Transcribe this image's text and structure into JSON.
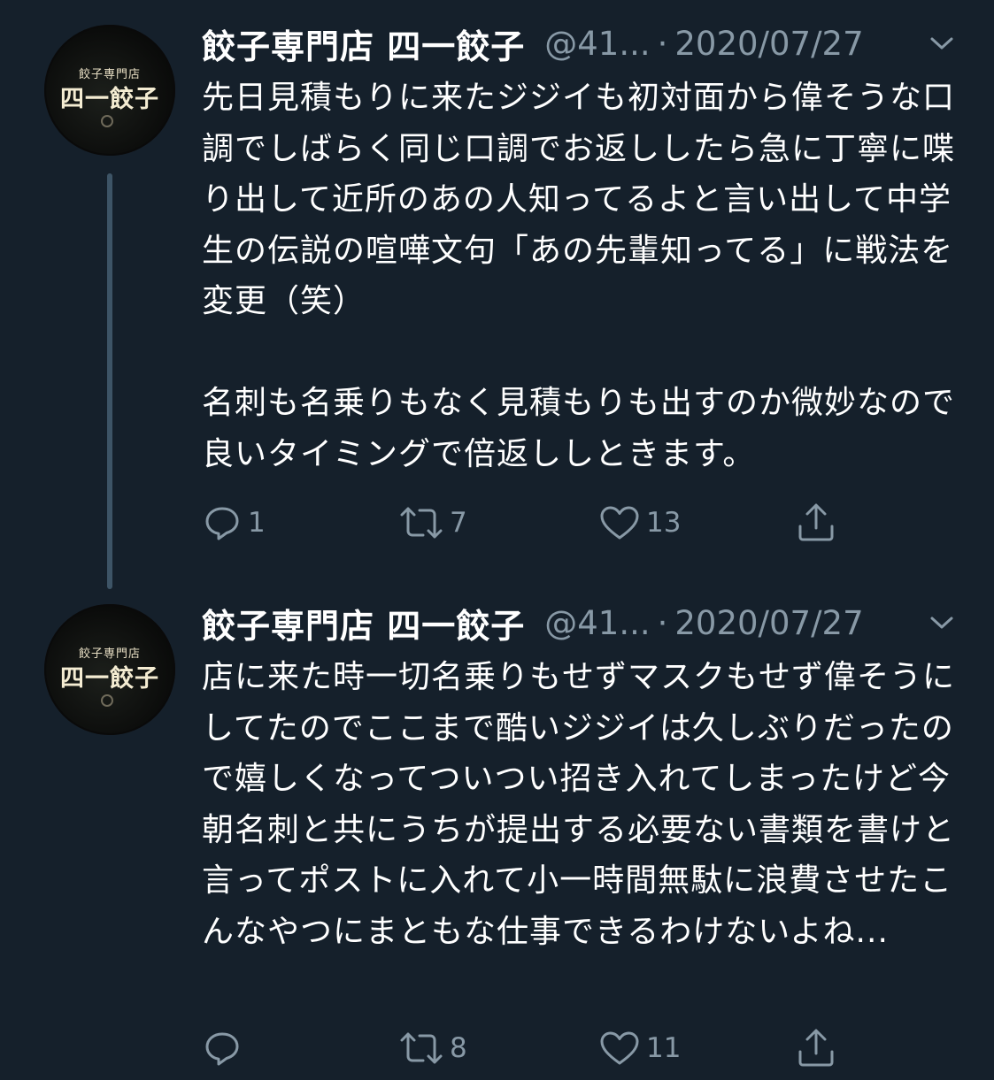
{
  "avatar": {
    "small_text": "餃子専門店",
    "big_text": "四一餃子"
  },
  "tweets": [
    {
      "display_name": "餃子専門店 四一餃子",
      "handle": "@41...",
      "separator": "·",
      "date": "2020/07/27",
      "text": "先日見積もりに来たジジイも初対面から偉そうな口調でしばらく同じ口調でお返ししたら急に丁寧に喋り出して近所のあの人知ってるよと言い出して中学生の伝説の喧嘩文句「あの先輩知ってる」に戦法を変更（笑）\n\n名刺も名乗りもなく見積もりも出すのか微妙なので良いタイミングで倍返ししときます。",
      "reply_count": "1",
      "retweet_count": "7",
      "like_count": "13"
    },
    {
      "display_name": "餃子専門店 四一餃子",
      "handle": "@41...",
      "separator": "·",
      "date": "2020/07/27",
      "text": "店に来た時一切名乗りもせずマスクもせず偉そうにしてたのでここまで酷いジジイは久しぶりだったので嬉しくなってついつい招き入れてしまったけど今朝名刺と共にうちが提出する必要ない書類を書けと言ってポストに入れて小一時間無駄に浪費させたこんなやつにまともな仕事できるわけないよね...",
      "reply_count": "",
      "retweet_count": "8",
      "like_count": "11"
    }
  ],
  "icons": {
    "reply": "reply-icon",
    "retweet": "retweet-icon",
    "like": "heart-icon",
    "share": "share-icon",
    "menu": "chevron-down-icon"
  },
  "colors": {
    "background": "#15202b",
    "text_primary": "#ffffff",
    "text_secondary": "#8899a6",
    "thread_line": "#3d5466"
  }
}
